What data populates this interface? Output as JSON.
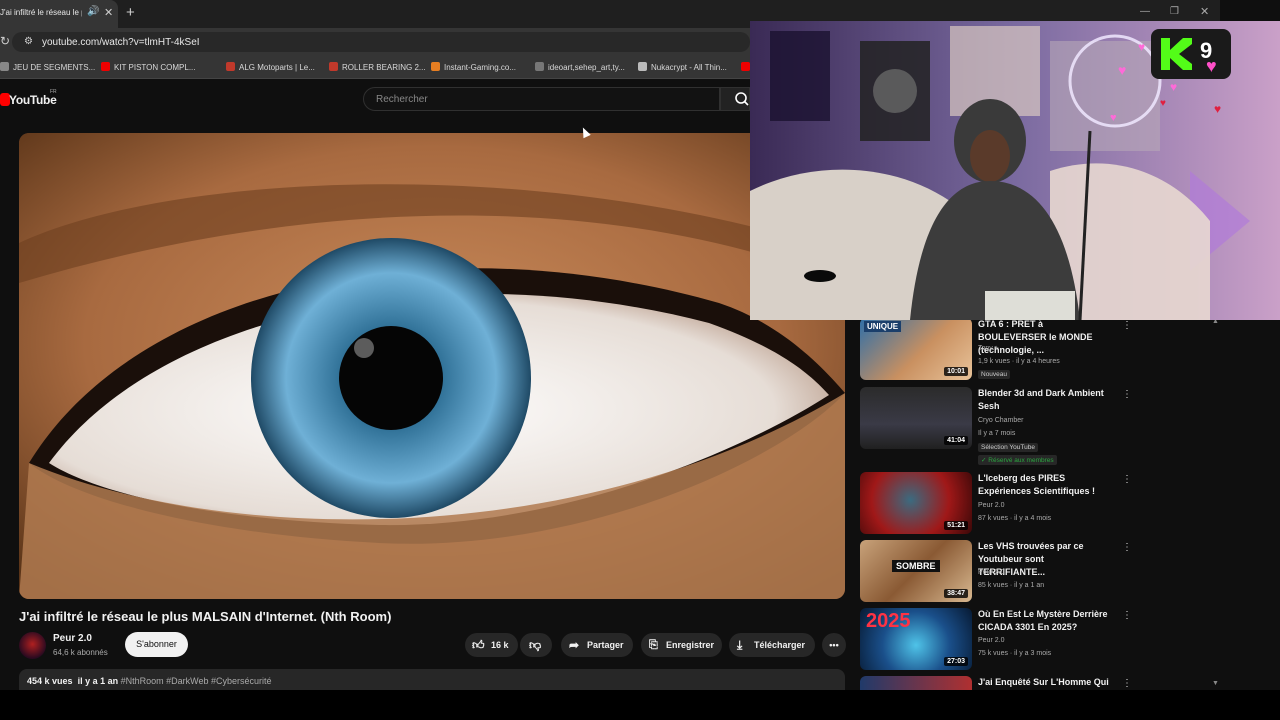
{
  "browser": {
    "tab_title": "J'ai infiltré le réseau le plus",
    "new_tab": "+",
    "url": "youtube.com/watch?v=tlmHT-4kSeI",
    "bookmarks": [
      {
        "label": "JEU DE SEGMENTS...",
        "color": "#888888"
      },
      {
        "label": "KIT PISTON COMPL...",
        "color": "#c0392b"
      },
      {
        "label": "ALG Motoparts | Le...",
        "color": "#c0392b"
      },
      {
        "label": "ROLLER BEARING 2...",
        "color": "#c0392b"
      },
      {
        "label": "Instant-Gaming.co...",
        "color": "#e67e22"
      },
      {
        "label": "ideoart,sehep_art,ty...",
        "color": "#777777"
      },
      {
        "label": "Nukacrypt - All Thin...",
        "color": "#bbbbbb"
      }
    ]
  },
  "youtube": {
    "logo": "YouTube",
    "region": "FR",
    "search_placeholder": "Rechercher"
  },
  "video": {
    "title": "J'ai infiltré le réseau le plus MALSAIN d'Internet. (Nth Room)",
    "channel": "Peur 2.0",
    "subscribers": "64,6 k abonnés",
    "subscribe_label": "S'abonner",
    "likes": "16 k",
    "share_label": "Partager",
    "save_label": "Enregistrer",
    "download_label": "Télécharger",
    "views": "454 k vues",
    "date": "il y a 1 an",
    "hashtags": "#NthRoom #DarkWeb #Cybersécurité"
  },
  "overlay": {
    "badge_number": "9"
  },
  "recommendations": [
    {
      "title": "GTA 6 : PRÊT à BOULEVERSER le MONDE (technologie, ...",
      "channel": "Tony +",
      "meta": "1,9 k vues · il y a 4 heures",
      "badge": "Nouveau",
      "duration": "10:01",
      "thumb_label": "UNIQUE"
    },
    {
      "title": "Blender 3d and Dark Ambient Sesh",
      "channel": "Cryo Chamber",
      "meta": "Il y a 7 mois",
      "badge": "Sélection YouTube",
      "members": "Réservé aux membres",
      "duration": "41:04"
    },
    {
      "title": "L'Iceberg des PIRES Expériences Scientifiques !",
      "channel": "Peur 2.0",
      "meta": "87 k vues · il y a 4 mois",
      "duration": "51:21"
    },
    {
      "title": "Les VHS trouvées par ce Youtubeur sont TERRIFIANTE...",
      "channel": "Peur 2.0",
      "meta": "85 k vues · il y a 1 an",
      "duration": "38:47",
      "thumb_label": "SOMBRE"
    },
    {
      "title": "Où En Est Le Mystère Derrière CICADA 3301 En 2025?",
      "channel": "Peur 2.0",
      "meta": "75 k vues · il y a 3 mois",
      "duration": "27:03",
      "thumb_label": "2025"
    },
    {
      "title": "J'ai Enquêté Sur L'Homme Qui"
    }
  ]
}
